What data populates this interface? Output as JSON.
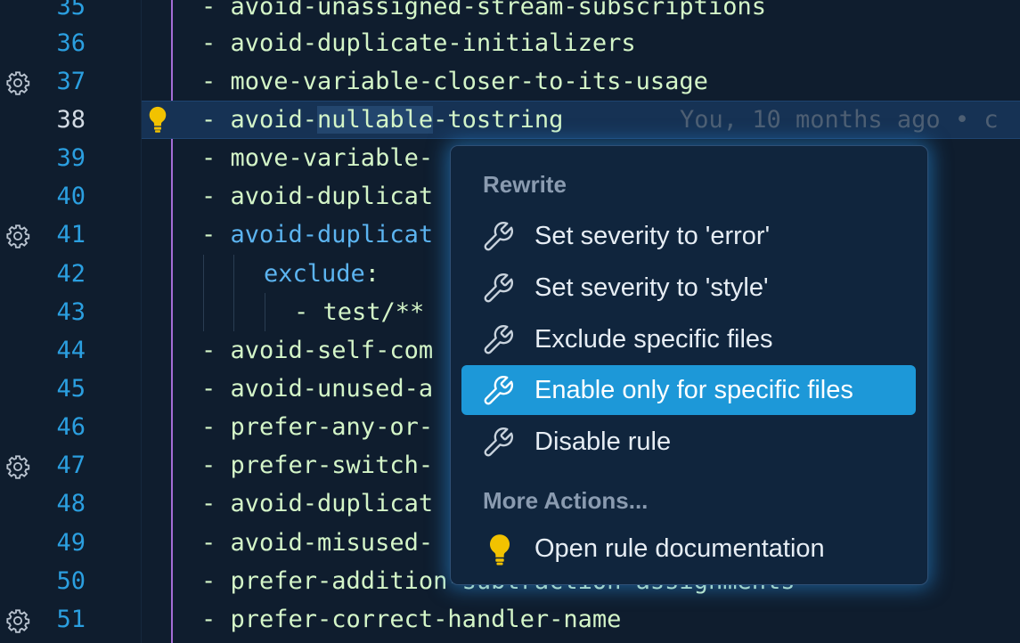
{
  "editor": {
    "lines": [
      {
        "number": "35",
        "text": "- avoid-unassigned-stream-subscriptions"
      },
      {
        "number": "36",
        "text": "- avoid-duplicate-initializers"
      },
      {
        "number": "37",
        "text": "- move-variable-closer-to-its-usage",
        "gear": true
      },
      {
        "number": "38",
        "text_prefix": "- avoid-",
        "text_highlight": "nullable",
        "text_suffix": "-tostring",
        "blame": "You, 10 months ago • c",
        "current": true
      },
      {
        "number": "39",
        "text": "- move-variable-"
      },
      {
        "number": "40",
        "text": "- avoid-duplicat"
      },
      {
        "number": "41",
        "text_prefix": "- ",
        "text_kw": "avoid-duplicat",
        "gear": true
      },
      {
        "number": "42",
        "text_kw_indent": "exclude",
        "text_after": ":"
      },
      {
        "number": "43",
        "text": "- test/**"
      },
      {
        "number": "44",
        "text": "- avoid-self-com"
      },
      {
        "number": "45",
        "text": "- avoid-unused-a"
      },
      {
        "number": "46",
        "text": "- prefer-any-or-"
      },
      {
        "number": "47",
        "text": "- prefer-switch-",
        "gear": true
      },
      {
        "number": "48",
        "text": "- avoid-duplicat"
      },
      {
        "number": "49",
        "text": "- avoid-misused-"
      },
      {
        "number": "50",
        "text": "- prefer-addition-subtraction-assignments"
      },
      {
        "number": "51",
        "text": "- prefer-correct-handler-name",
        "gear": true
      }
    ]
  },
  "popup": {
    "rewrite_header": "Rewrite",
    "items": [
      {
        "label": "Set severity to 'error'",
        "icon": "wrench-icon"
      },
      {
        "label": "Set severity to 'style'",
        "icon": "wrench-icon"
      },
      {
        "label": "Exclude specific files",
        "icon": "wrench-icon"
      },
      {
        "label": "Enable only for specific files",
        "icon": "wrench-icon",
        "selected": true
      },
      {
        "label": "Disable rule",
        "icon": "wrench-icon"
      }
    ],
    "more_header": "More Actions...",
    "more_items": [
      {
        "label": "Open rule documentation",
        "icon": "lightbulb-icon"
      }
    ]
  },
  "colors": {
    "background": "#0f1d2e",
    "line_number": "#2b9fe0",
    "code_text": "#d4f5c8",
    "keyword": "#5cb4f0",
    "selected_item": "#1d98d8",
    "git_bar": "#a46dd6",
    "bulb": "#f2c200"
  }
}
